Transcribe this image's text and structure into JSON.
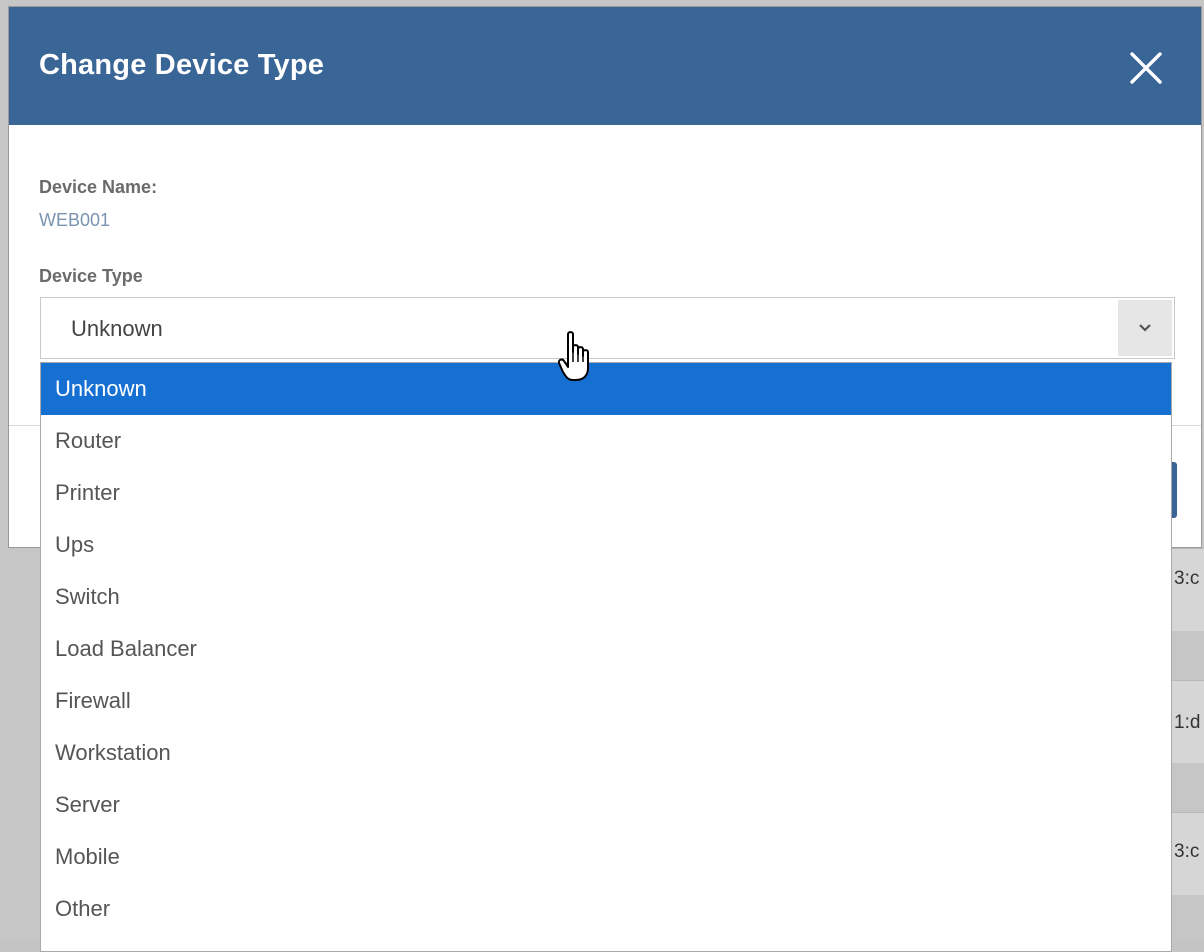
{
  "background": {
    "fragments": [
      "3:c",
      "1:d",
      "3:c"
    ]
  },
  "dialog": {
    "title": "Change Device Type",
    "close_icon": "close-icon",
    "header_color": "#3a6597",
    "device_name_label": "Device Name:",
    "device_name_value": "WEB001",
    "device_type_label": "Device Type",
    "selected_value": "Unknown"
  },
  "dropdown": {
    "highlight_color": "#1670d2",
    "options": [
      "Unknown",
      "Router",
      "Printer",
      "Ups",
      "Switch",
      "Load Balancer",
      "Firewall",
      "Workstation",
      "Server",
      "Mobile",
      "Other"
    ],
    "highlighted_index": 0
  }
}
